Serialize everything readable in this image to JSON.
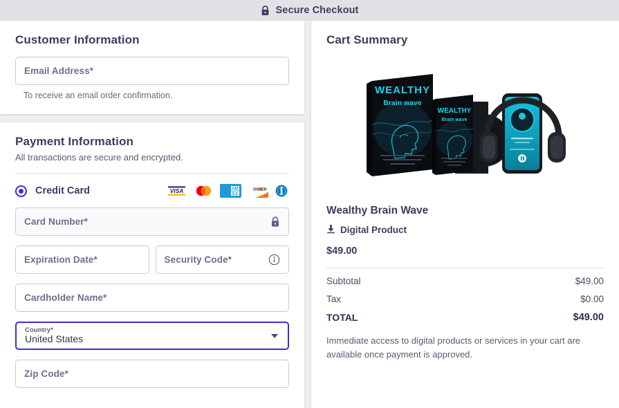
{
  "header": {
    "title": "Secure Checkout",
    "lock_icon": "lock-icon"
  },
  "customer": {
    "title": "Customer Information",
    "email_placeholder": "Email Address*",
    "email_value": "",
    "helper": "To receive an email order confirmation."
  },
  "payment": {
    "title": "Payment Information",
    "subtitle": "All transactions are secure and encrypted.",
    "method_label": "Credit Card",
    "method_selected": true,
    "accepted_cards": [
      "VISA",
      "Mastercard",
      "AMEX",
      "DISCOVER",
      "Diners Club"
    ],
    "fields": {
      "card_number_placeholder": "Card Number*",
      "card_number_value": "",
      "card_number_icon": "lock-icon",
      "expiration_placeholder": "Expiration Date*",
      "expiration_value": "",
      "security_code_placeholder": "Security Code*",
      "security_code_value": "",
      "security_code_icon": "info-circle-icon",
      "cardholder_placeholder": "Cardholder Name*",
      "cardholder_value": "",
      "country_label": "Country*",
      "country_value": "United States",
      "zip_placeholder": "Zip Code*",
      "zip_value": ""
    }
  },
  "cart": {
    "title": "Cart Summary",
    "product": {
      "name": "Wealthy Brain Wave",
      "type": "Digital Product",
      "type_icon": "download-icon",
      "price": "$49.00",
      "image_title_line1": "WEALTHY",
      "image_title_line2": "Brain wave"
    },
    "totals": [
      {
        "label": "Subtotal",
        "amount": "$49.00"
      },
      {
        "label": "Tax",
        "amount": "$0.00"
      }
    ],
    "grand_total": {
      "label": "TOTAL",
      "amount": "$49.00"
    },
    "fine_print": "Immediate access to digital products or services in your cart are available once payment is approved."
  },
  "colors": {
    "accent": "#3a2fd4",
    "text": "#3d3c62",
    "header_bg": "#e2e2e6",
    "page_bg": "#eeeef0",
    "product_cyan": "#18c9e8"
  }
}
